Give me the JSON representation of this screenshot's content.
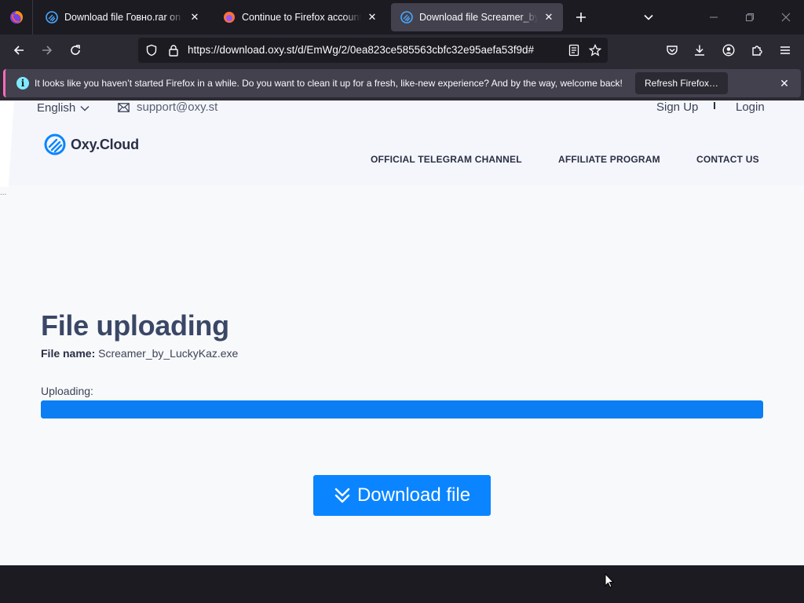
{
  "tabs": [
    {
      "title": "Download file Говно.rar on Oxy",
      "active": false
    },
    {
      "title": "Continue to Firefox accounts",
      "active": false
    },
    {
      "title": "Download file Screamer_by_LuckyKaz.exe",
      "active": true
    }
  ],
  "url": "https://download.oxy.st/d/EmWg/2/0ea823ce585563cbfc32e95aefa53f9d#",
  "notification": {
    "message": "It looks like you haven’t started Firefox in a while. Do you want to clean it up for a fresh, like-new experience? And by the way, welcome back!",
    "button": "Refresh Firefox…"
  },
  "site": {
    "language": "English",
    "support_email": "support@oxy.st",
    "sign_up": "Sign Up",
    "login": "Login",
    "logo": "Oxy.Cloud",
    "nav": [
      "OFFICIAL TELEGRAM CHANNEL",
      "AFFILIATE PROGRAM",
      "CONTACT US"
    ],
    "dots": "...",
    "heading": "File uploading",
    "file_name_label": "File name:",
    "file_name": "Screamer_by_LuckyKaz.exe",
    "uploading_label": "Uploading:",
    "progress": 1.0,
    "download_button": "Download file"
  },
  "colors": {
    "accent": "#0a85ff",
    "progress": "#0a7ef2",
    "heading": "#3a4766",
    "notification_stripe": "#ff6bba"
  }
}
